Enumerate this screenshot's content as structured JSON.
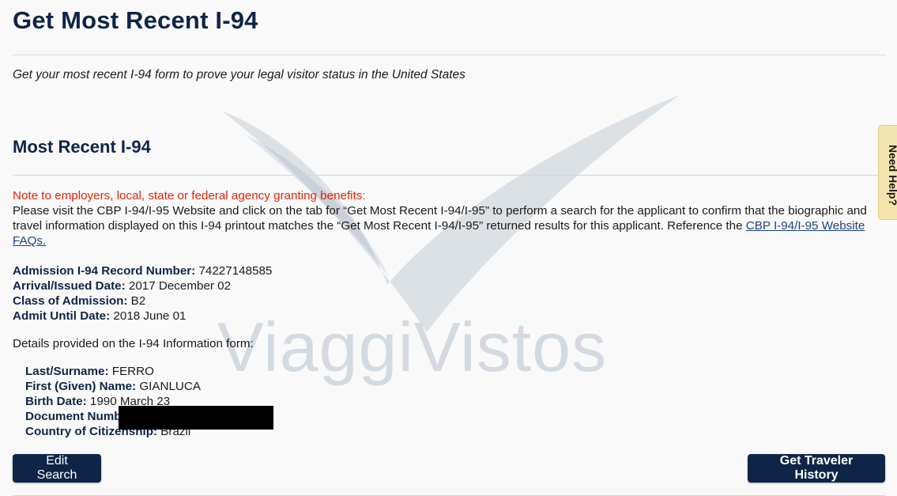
{
  "header": {
    "title": "Get Most Recent I-94",
    "subtitle": "Get your most recent I-94 form to prove your legal visitor status in the United States"
  },
  "section": {
    "title": "Most Recent I-94"
  },
  "note": {
    "heading": "Note to employers, local, state or federal agency granting benefits:",
    "body": "Please visit the CBP I-94/I-95 Website and click on the tab for “Get Most Recent I-94/I-95” to perform a search for the applicant to confirm that the biographic and travel information displayed on this I-94 printout matches the “Get Most Recent I-94/I-95” returned results for this applicant. Reference the",
    "link_text": "CBP I-94/I-95 Website FAQs."
  },
  "record": {
    "record_number_label": "Admission I-94 Record Number:",
    "record_number_value": "74227148585",
    "arrival_label": "Arrival/Issued Date:",
    "arrival_value": "2017 December 02",
    "class_label": "Class of Admission:",
    "class_value": "B2",
    "admit_until_label": "Admit Until Date:",
    "admit_until_value": "2018 June 01"
  },
  "details": {
    "intro": "Details provided on the I-94 Information form:",
    "surname_label": "Last/Surname:",
    "surname_value": "FERRO",
    "given_label": "First (Given) Name:",
    "given_value": "GIANLUCA",
    "birth_label": "Birth Date:",
    "birth_value": "1990 March 23",
    "document_label": "Document Numb",
    "citizenship_label": "Country of Citizenship:",
    "citizenship_value": "Brazil"
  },
  "buttons": {
    "edit_search": "Edit Search",
    "traveler_history": "Get Traveler History"
  },
  "help_tab": {
    "label": "Need Help?"
  },
  "watermark": {
    "text": "ViaggiVistos"
  },
  "colors": {
    "primary": "#0f2547",
    "note_red": "#e52207",
    "link": "#1a4480",
    "help_tab": "#f4e4b0",
    "background": "#f9f9f9"
  }
}
